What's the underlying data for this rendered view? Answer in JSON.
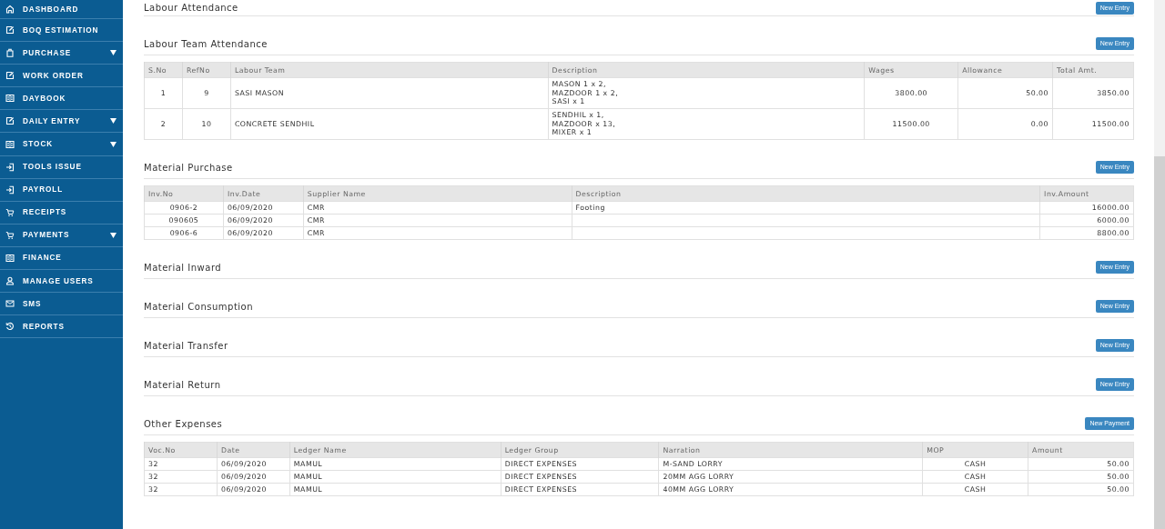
{
  "sidebar": {
    "items": [
      {
        "label": "DASHBOARD",
        "has_submenu": false
      },
      {
        "label": "BOQ ESTIMATION",
        "has_submenu": false
      },
      {
        "label": "PURCHASE",
        "has_submenu": true
      },
      {
        "label": "WORK ORDER",
        "has_submenu": false
      },
      {
        "label": "DAYBOOK",
        "has_submenu": false
      },
      {
        "label": "DAILY ENTRY",
        "has_submenu": true
      },
      {
        "label": "STOCK",
        "has_submenu": true
      },
      {
        "label": "TOOLS ISSUE",
        "has_submenu": false
      },
      {
        "label": "PAYROLL",
        "has_submenu": false
      },
      {
        "label": "RECEIPTS",
        "has_submenu": false
      },
      {
        "label": "PAYMENTS",
        "has_submenu": true
      },
      {
        "label": "FINANCE",
        "has_submenu": false
      },
      {
        "label": "MANAGE USERS",
        "has_submenu": false
      },
      {
        "label": "SMS",
        "has_submenu": false
      },
      {
        "label": "REPORTS",
        "has_submenu": false
      }
    ]
  },
  "sections": [
    {
      "title": "Labour Attendance",
      "button": "New Entry"
    },
    {
      "title": "Labour Team Attendance",
      "button": "New Entry",
      "table": {
        "columns": [
          "S.No",
          "RefNo",
          "Labour Team",
          "Description",
          "Wages",
          "Allowance",
          "Total Amt."
        ],
        "rows": [
          [
            "1",
            "9",
            "SASI MASON",
            "MASON 1 x 2,\nMAZDOOR 1 x 2,\nSASI x 1",
            "3800.00",
            "50.00",
            "3850.00"
          ],
          [
            "2",
            "10",
            "CONCRETE SENDHIL",
            "SENDHIL x 1,\nMAZDOOR x 13,\nMIXER x 1",
            "11500.00",
            "0.00",
            "11500.00"
          ]
        ]
      }
    },
    {
      "title": "Material Purchase",
      "button": "New Entry",
      "table": {
        "columns": [
          "Inv.No",
          "Inv.Date",
          "Supplier Name",
          "Description",
          "Inv.Amount"
        ],
        "rows": [
          [
            "0906-2",
            "06/09/2020",
            "CMR",
            "Footing",
            "16000.00"
          ],
          [
            "090605",
            "06/09/2020",
            "CMR",
            "",
            "6000.00"
          ],
          [
            "0906-6",
            "06/09/2020",
            "CMR",
            "",
            "8800.00"
          ]
        ]
      }
    },
    {
      "title": "Material Inward",
      "button": "New Entry"
    },
    {
      "title": "Material Consumption",
      "button": "New Entry"
    },
    {
      "title": "Material Transfer",
      "button": "New Entry"
    },
    {
      "title": "Material Return",
      "button": "New Entry"
    },
    {
      "title": "Other Expenses",
      "button": "New Payment",
      "table": {
        "columns": [
          "Voc.No",
          "Date",
          "Ledger Name",
          "Ledger Group",
          "Narration",
          "MOP",
          "Amount"
        ],
        "rows": [
          [
            "32",
            "06/09/2020",
            "MAMUL",
            "DIRECT EXPENSES",
            "M-SAND LORRY",
            "CASH",
            "50.00"
          ],
          [
            "32",
            "06/09/2020",
            "MAMUL",
            "DIRECT EXPENSES",
            "20MM AGG LORRY",
            "CASH",
            "50.00"
          ],
          [
            "32",
            "06/09/2020",
            "MAMUL",
            "DIRECT EXPENSES",
            "40MM AGG LORRY",
            "CASH",
            "50.00"
          ]
        ]
      }
    }
  ]
}
